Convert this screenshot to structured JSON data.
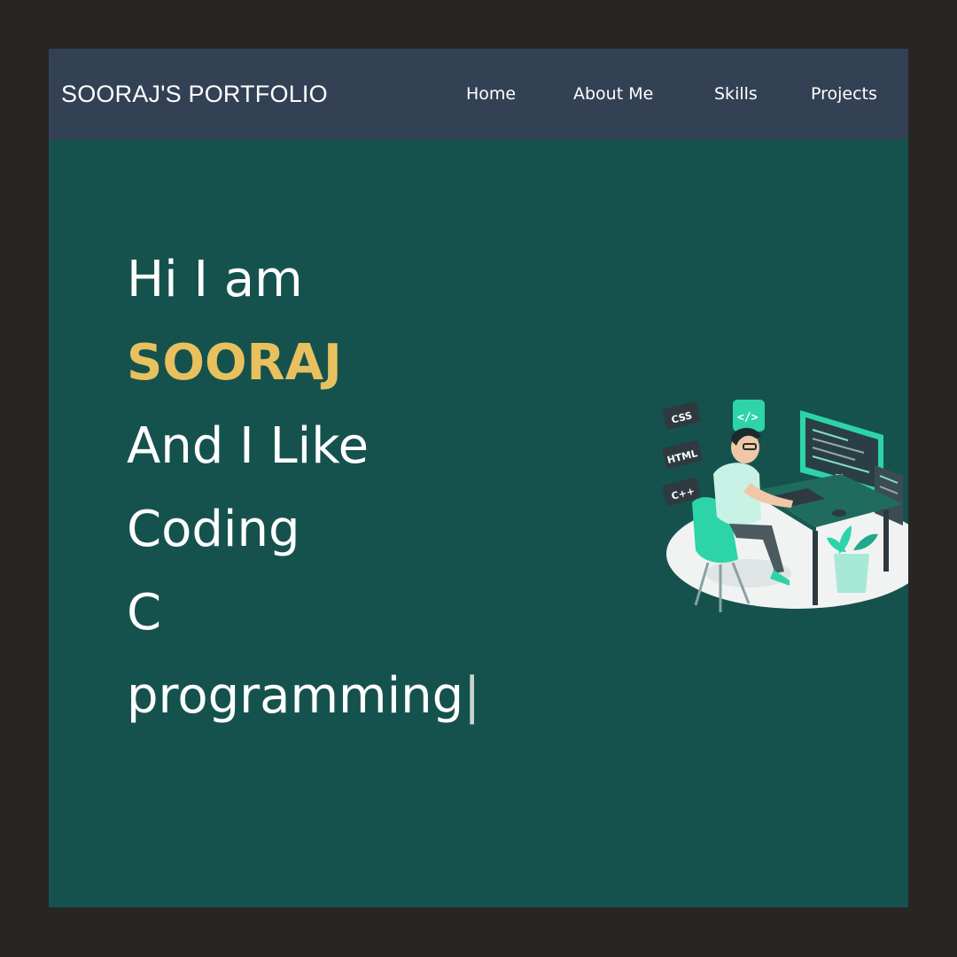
{
  "nav": {
    "brand": "SOORAJ'S PORTFOLIO",
    "links": [
      "Home",
      "About Me",
      "Skills",
      "Projects"
    ]
  },
  "hero": {
    "greeting": "Hi I am",
    "name": "SOORAJ",
    "line3": "And I Like",
    "line4": "Coding",
    "line5": "C",
    "line6": "programming",
    "cursor": "|"
  },
  "illustration": {
    "icon": "developer-at-desk-illustration",
    "tags": [
      "CSS",
      "HTML",
      "C++"
    ],
    "code_bubble": "</>"
  },
  "colors": {
    "page_border": "#292524",
    "navbar": "#334155",
    "hero_bg": "#15524d",
    "accent_name": "#e8c15e",
    "illustration_accent": "#2dd4a8"
  }
}
